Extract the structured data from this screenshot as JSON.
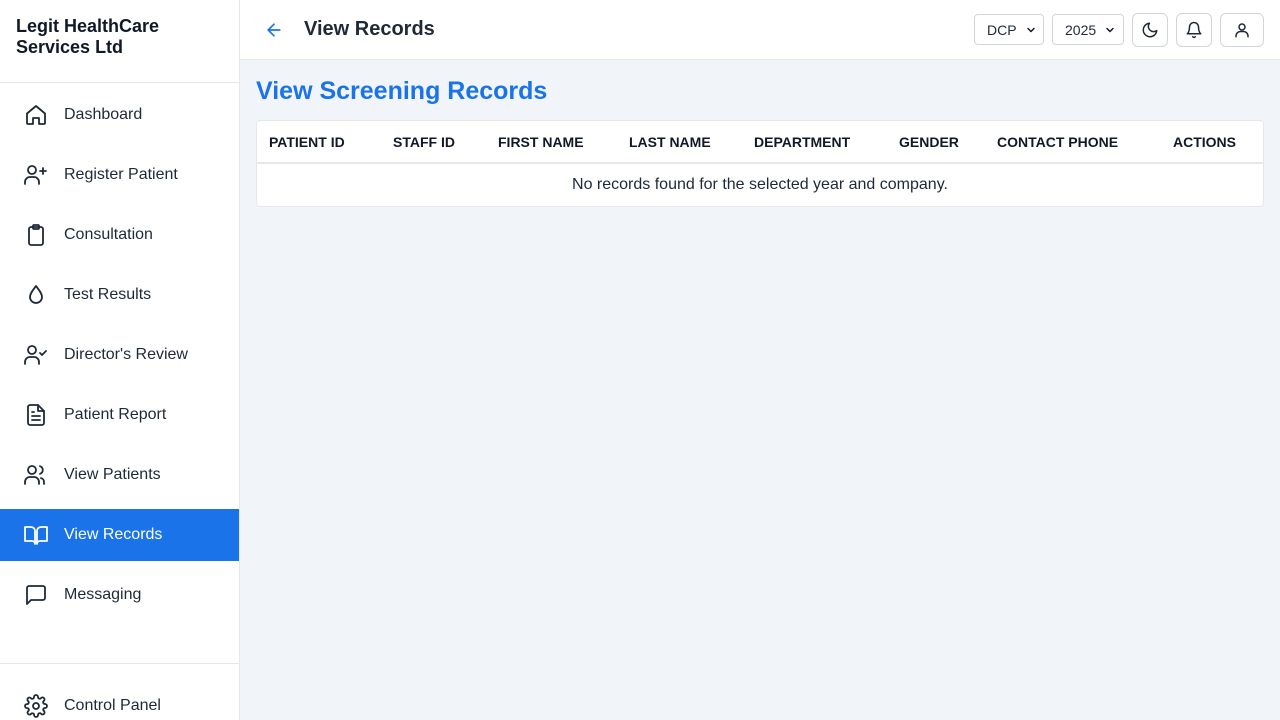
{
  "brand": {
    "name": "Legit HealthCare Services Ltd"
  },
  "sidebar": {
    "items": [
      {
        "label": "Dashboard",
        "icon": "home-icon"
      },
      {
        "label": "Register Patient",
        "icon": "user-plus-icon"
      },
      {
        "label": "Consultation",
        "icon": "clipboard-icon"
      },
      {
        "label": "Test Results",
        "icon": "droplet-icon"
      },
      {
        "label": "Director's Review",
        "icon": "user-check-icon"
      },
      {
        "label": "Patient Report",
        "icon": "file-text-icon"
      },
      {
        "label": "View Patients",
        "icon": "users-icon"
      },
      {
        "label": "View Records",
        "icon": "book-open-icon"
      },
      {
        "label": "Messaging",
        "icon": "message-square-icon"
      }
    ],
    "active": "View Records",
    "footer": {
      "label": "Control Panel",
      "icon": "settings-icon"
    }
  },
  "header": {
    "title": "View Records",
    "company_select": {
      "value": "DCP"
    },
    "year_select": {
      "value": "2025"
    }
  },
  "main": {
    "page_title": "View Screening Records",
    "table": {
      "columns": [
        "PATIENT ID",
        "STAFF ID",
        "FIRST NAME",
        "LAST NAME",
        "DEPARTMENT",
        "GENDER",
        "CONTACT PHONE",
        "ACTIONS"
      ],
      "empty_message": "No records found for the selected year and company."
    }
  },
  "colors": {
    "accent": "#1a73e8",
    "background": "#f1f5f9",
    "sidebar_bg": "#ffffff"
  }
}
